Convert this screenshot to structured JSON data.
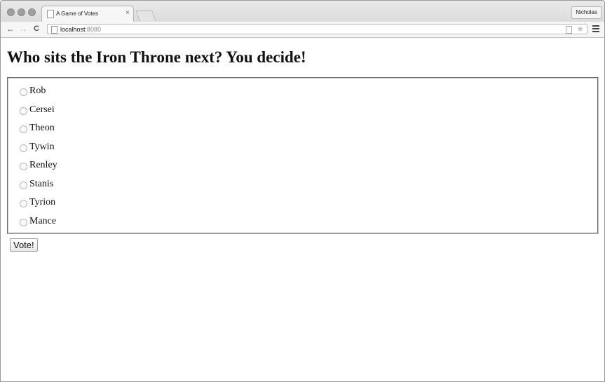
{
  "browser": {
    "tab_title": "A Game of Votes",
    "tab_close": "×",
    "profile_name": "Nicholas",
    "url_host": "localhost",
    "url_port": ":8080",
    "back_glyph": "←",
    "forward_glyph": "→",
    "reload_glyph": "C",
    "star_glyph": "★"
  },
  "page": {
    "heading": "Who sits the Iron Throne next? You decide!",
    "options": [
      {
        "label": "Rob",
        "checked": false
      },
      {
        "label": "Cersei",
        "checked": false
      },
      {
        "label": "Theon",
        "checked": false
      },
      {
        "label": "Tywin",
        "checked": false
      },
      {
        "label": "Renley",
        "checked": false
      },
      {
        "label": "Stanis",
        "checked": false
      },
      {
        "label": "Tyrion",
        "checked": false
      },
      {
        "label": "Mance",
        "checked": false
      }
    ],
    "submit_label": "Vote!"
  }
}
